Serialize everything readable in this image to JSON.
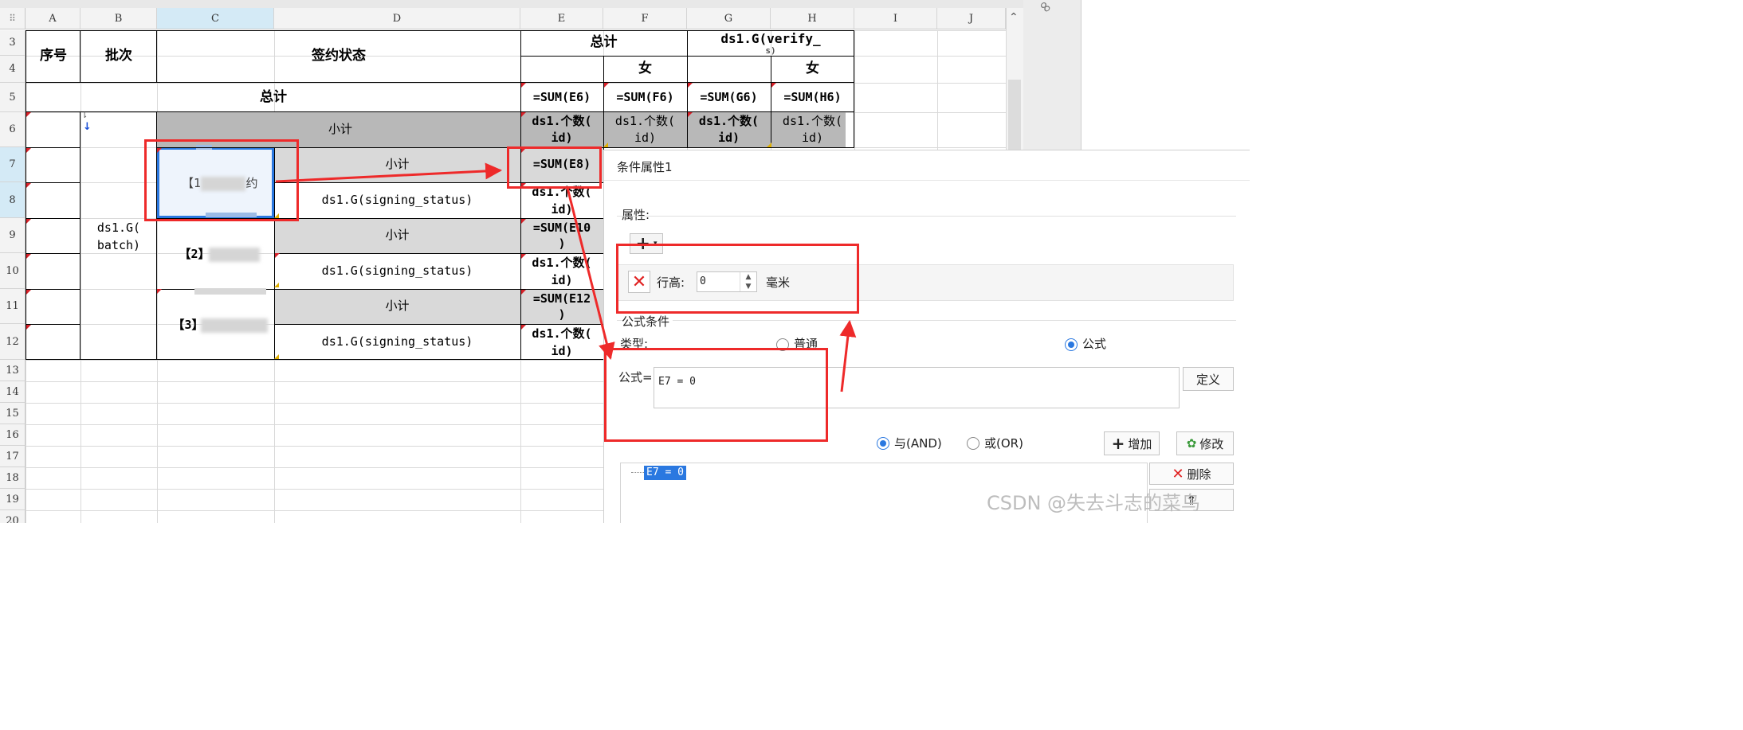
{
  "colors": {
    "accent_red": "#ee2a2a",
    "selection_blue": "#2a78e0",
    "header_bg": "#f3f3f3",
    "gray_row": "#b8b8b8",
    "light_gray_row": "#d9d9d9"
  },
  "columns": [
    "A",
    "B",
    "C",
    "D",
    "E",
    "F",
    "G",
    "H",
    "I",
    "J"
  ],
  "rows": [
    "3",
    "4",
    "5",
    "6",
    "7",
    "8",
    "9",
    "10",
    "11",
    "12",
    "13",
    "14",
    "15",
    "16",
    "17",
    "18",
    "19",
    "20"
  ],
  "header": {
    "seq": "序号",
    "batch": "批次",
    "status": "签约状态",
    "total": "总计",
    "verify_line1": "ds1.G(verify_",
    "verify_line2": "s)",
    "female": "女",
    "female2": "女"
  },
  "row5": {
    "total": "总计",
    "e": "=SUM(E6)",
    "f": "=SUM(F6)",
    "g": "=SUM(G6)",
    "h": "=SUM(H6)"
  },
  "row6": {
    "subtotal": "小计",
    "e1": "ds1.个数(",
    "e2": "id)",
    "f1": "ds1.个数(",
    "f2": "id)",
    "g1": "ds1.个数(",
    "g2": "id)",
    "h1": "ds1.个数(",
    "h2": "id)"
  },
  "batch_line1": "ds1.G(",
  "batch_line2": "batch)",
  "c7": "【1",
  "c7_tail": "约",
  "c9": "【2】",
  "c11": "【3】",
  "d7": "小计",
  "d8": "ds1.G(signing_status)",
  "d9": "小计",
  "d10": "ds1.G(signing_status)",
  "d11": "小计",
  "d12": "ds1.G(signing_status)",
  "e7": "=SUM(E8)",
  "e8_1": "ds1.个数(",
  "e8_2": "id)",
  "e9_1": "=SUM(E10",
  "e9_2": ")",
  "e10_1": "ds1.个数(",
  "e10_2": "id)",
  "e11_1": "=SUM(E12",
  "e11_2": ")",
  "e12_1": "ds1.个数(",
  "e12_2": "id)",
  "dialog": {
    "title": "条件属性1",
    "attr_label": "属性:",
    "add_icon": "plus-icon",
    "row_height_label": "行高:",
    "row_height_value": "0",
    "unit": "毫米",
    "formula_section": "公式条件",
    "type_label": "类型:",
    "type_normal": "普通",
    "type_formula": "公式",
    "formula_label": "公式=",
    "formula_value": "E7 = 0",
    "define_button": "定义",
    "and_label": "与(AND)",
    "or_label": "或(OR)",
    "add_button": "增加",
    "modify_button": "修改",
    "delete_button": "删除",
    "condition_item": "E7 = 0"
  },
  "watermark": "CSDN @失去斗志的菜鸟"
}
